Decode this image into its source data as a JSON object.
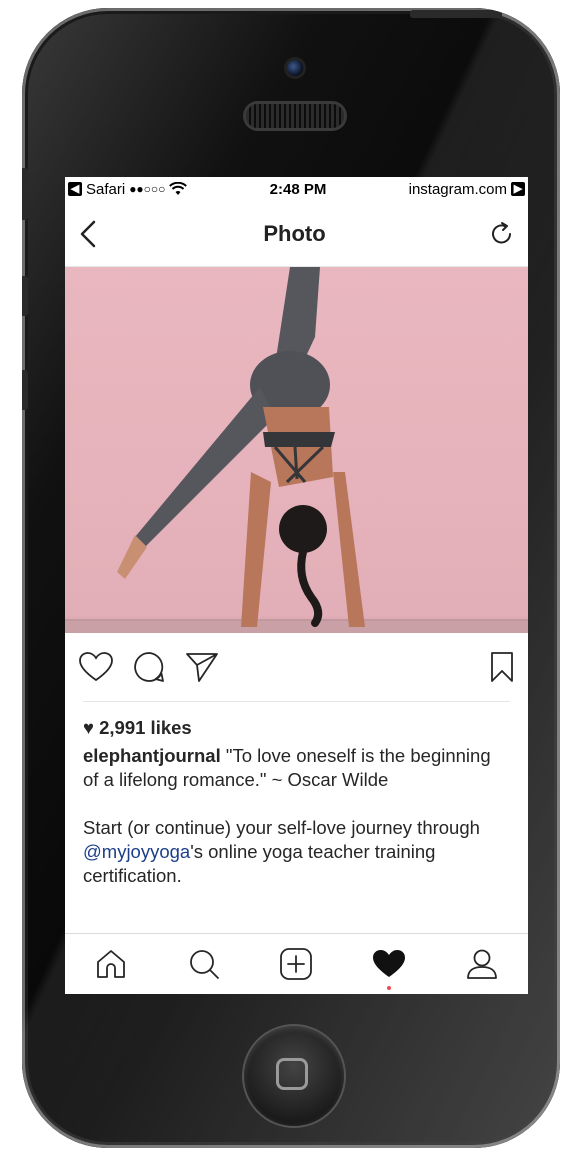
{
  "status_bar": {
    "back_app": "Safari",
    "signal": "●●○○○",
    "time": "2:48 PM",
    "domain": "instagram.com"
  },
  "nav": {
    "title": "Photo"
  },
  "post": {
    "likes": "2,991 likes",
    "username": "elephantjournal",
    "caption": " \"To love oneself is the beginning of a lifelong romance.\" ~ Oscar Wilde",
    "paragraph2_before": "Start (or continue) your self-love journey through ",
    "mention": "@myjoyyoga",
    "paragraph2_after": "'s online yoga teacher training certification."
  },
  "icons": {
    "back": "chevron-left-icon",
    "refresh": "refresh-icon",
    "like": "heart-outline-icon",
    "comment": "comment-icon",
    "share": "paper-plane-icon",
    "save": "bookmark-icon",
    "home": "home-icon",
    "search": "search-icon",
    "add": "add-post-icon",
    "activity": "heart-filled-icon",
    "profile": "profile-icon"
  },
  "colors": {
    "photo_background": "#e9b7bf",
    "mention_link": "#1d3f8a",
    "activity_dot": "#ed4956"
  }
}
